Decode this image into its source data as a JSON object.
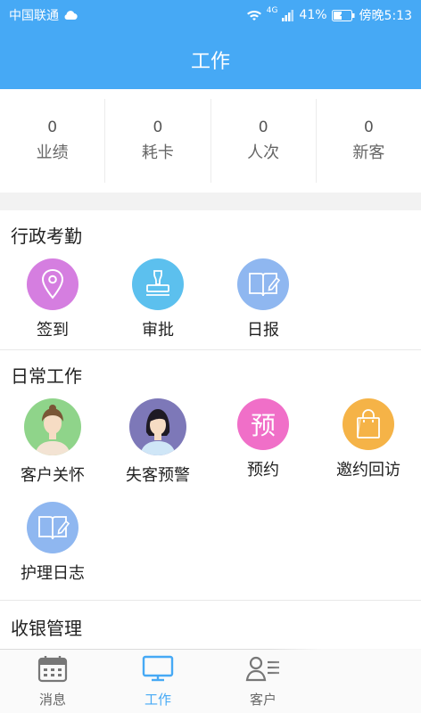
{
  "status_bar": {
    "carrier": "中国联通",
    "network": "4G",
    "battery": "41%",
    "time": "傍晚5:13"
  },
  "header": {
    "title": "工作"
  },
  "stats": [
    {
      "value": "0",
      "label": "业绩"
    },
    {
      "value": "0",
      "label": "耗卡"
    },
    {
      "value": "0",
      "label": "人次"
    },
    {
      "value": "0",
      "label": "新客"
    }
  ],
  "sections": {
    "admin": {
      "title": "行政考勤",
      "items": [
        {
          "label": "签到",
          "icon": "location-pin-icon",
          "color": "#d57ee0"
        },
        {
          "label": "审批",
          "icon": "stamp-icon",
          "color": "#5cc0ee"
        },
        {
          "label": "日报",
          "icon": "notebook-pencil-icon",
          "color": "#8fb7f0"
        }
      ]
    },
    "daily": {
      "title": "日常工作",
      "items": [
        {
          "label": "客户关怀",
          "icon": "woman-avatar-icon",
          "color": "#8fd48a"
        },
        {
          "label": "失客预警",
          "icon": "woman-dark-hair-avatar-icon",
          "color": "#7d78b8"
        },
        {
          "label": "预约",
          "icon": "appointment-char-icon",
          "color": "#f06fc8",
          "glyph": "预"
        },
        {
          "label": "邀约回访",
          "icon": "shopping-bag-icon",
          "color": "#f5b347"
        },
        {
          "label": "护理日志",
          "icon": "notebook-pencil-icon",
          "color": "#8fb7f0"
        }
      ]
    },
    "cashier": {
      "title": "收银管理"
    }
  },
  "tabbar": {
    "items": [
      {
        "label": "消息",
        "icon": "calendar-icon",
        "active": false
      },
      {
        "label": "工作",
        "icon": "monitor-icon",
        "active": true
      },
      {
        "label": "客户",
        "icon": "customer-list-icon",
        "active": false
      }
    ],
    "active_color": "#46a9f5"
  },
  "colors": {
    "brand": "#46a9f5"
  }
}
